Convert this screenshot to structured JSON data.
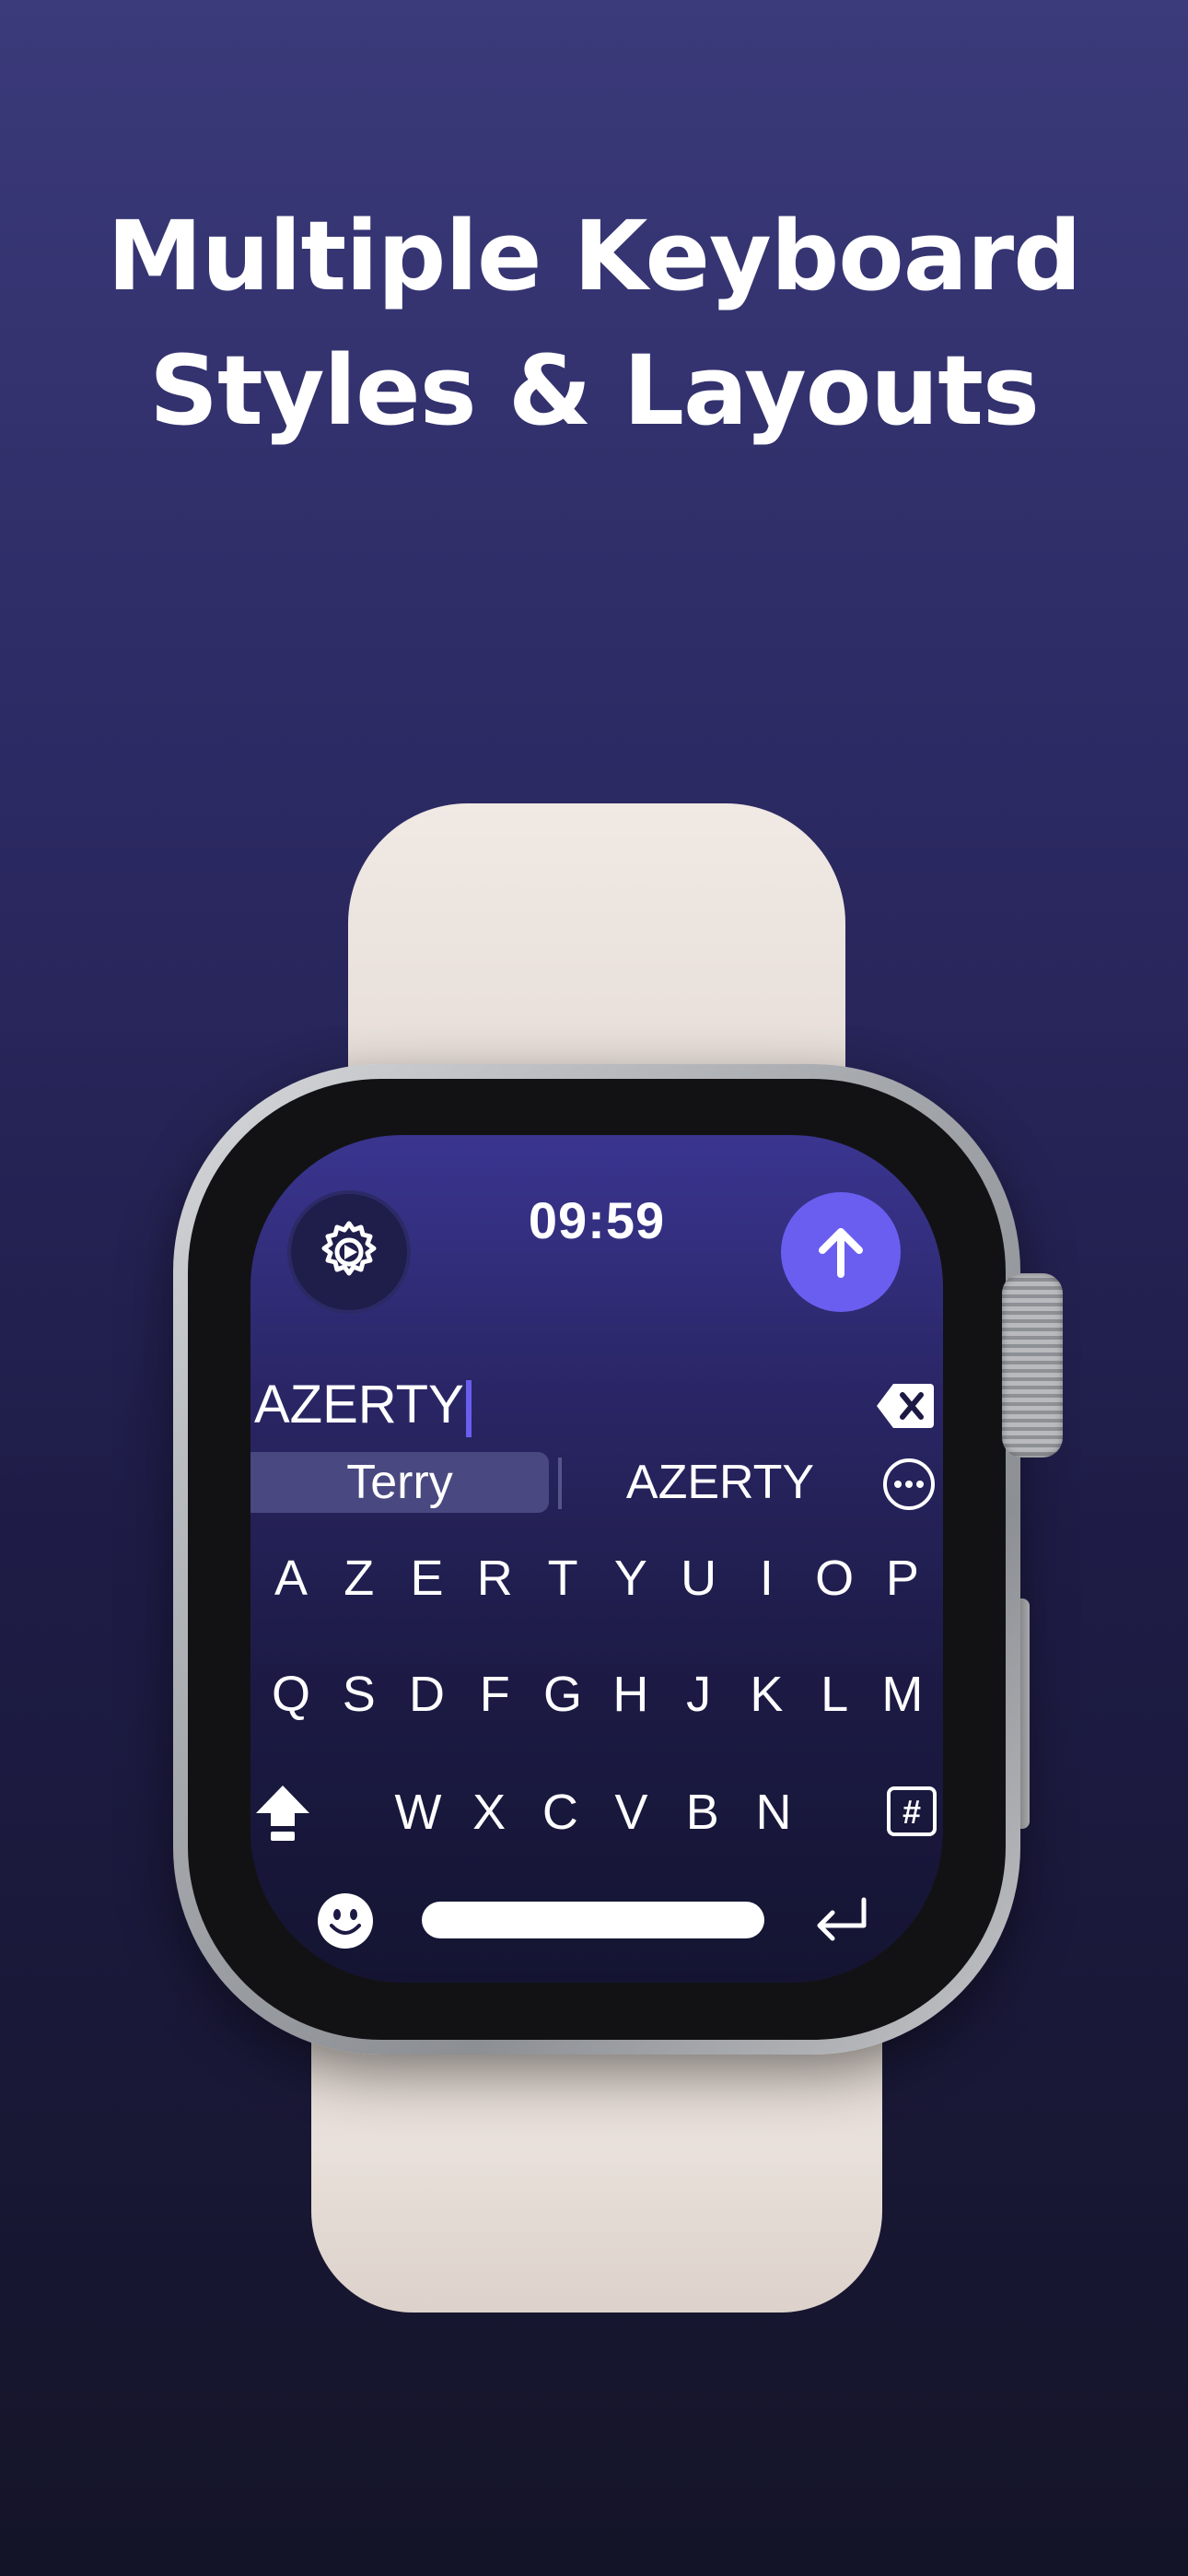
{
  "headline": {
    "line1": "Multiple Keyboard",
    "line2": "Styles & Layouts"
  },
  "watch": {
    "time": "09:59",
    "input_text": "AZERTY",
    "suggestions": [
      "Terry",
      "AZERTY"
    ],
    "keyboard": {
      "row1": [
        "A",
        "Z",
        "E",
        "R",
        "T",
        "Y",
        "U",
        "I",
        "O",
        "P"
      ],
      "row2": [
        "Q",
        "S",
        "D",
        "F",
        "G",
        "H",
        "J",
        "K",
        "L",
        "M"
      ],
      "row3": [
        "W",
        "X",
        "C",
        "V",
        "B",
        "N"
      ],
      "symbol_key": "#"
    },
    "icons": {
      "settings": "gear-icon",
      "send": "arrow-up-icon",
      "delete": "delete-icon",
      "more": "ellipsis-icon",
      "shift": "shift-icon",
      "emoji": "emoji-icon",
      "return": "return-icon"
    },
    "accent_color": "#6a5ef0"
  }
}
